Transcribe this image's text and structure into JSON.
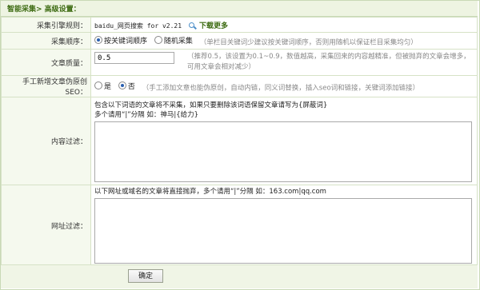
{
  "header": {
    "title": "智能采集> 高级设置："
  },
  "rules": {
    "label": "采集引擎规则：",
    "value": "baidu_网页搜索 for v2.21",
    "download_label": "下载更多"
  },
  "order": {
    "label": "采集顺序：",
    "options": [
      "按关键词顺序",
      "随机采集"
    ],
    "selected": 0,
    "hint": "（单栏目关键词少建议按关键词顺序，否则用随机以保证栏目采集均匀）"
  },
  "quality": {
    "label": "文章质量：",
    "value": "0.5",
    "hint": "（推荐0.5，该设置为0.1~0.9，数值越高，采集回来的内容越精准，但被抛弃的文章会增多，可用文章会相对减少）"
  },
  "original": {
    "label": "手工新增文章伪原创SEO：",
    "options": [
      "是",
      "否"
    ],
    "selected": 1,
    "hint": "（手工添加文章也能伪原创，自动内链，同义词替换，插入seo词和链接，关键词添加链接）"
  },
  "content_filter": {
    "label": "内容过滤：",
    "desc_line1": "包含以下词语的文章将不采集，如果只要删除该词语保留文章请写为{屏蔽词}",
    "desc_line2": "多个请用“|”分隔 如：神马|{给力}",
    "value": ""
  },
  "url_filter": {
    "label": "网址过滤：",
    "desc": "以下网址或域名的文章将直接抛弃，多个请用“|”分隔 如：163.com|qq.com",
    "value": ""
  },
  "submit": {
    "label": "确定"
  }
}
